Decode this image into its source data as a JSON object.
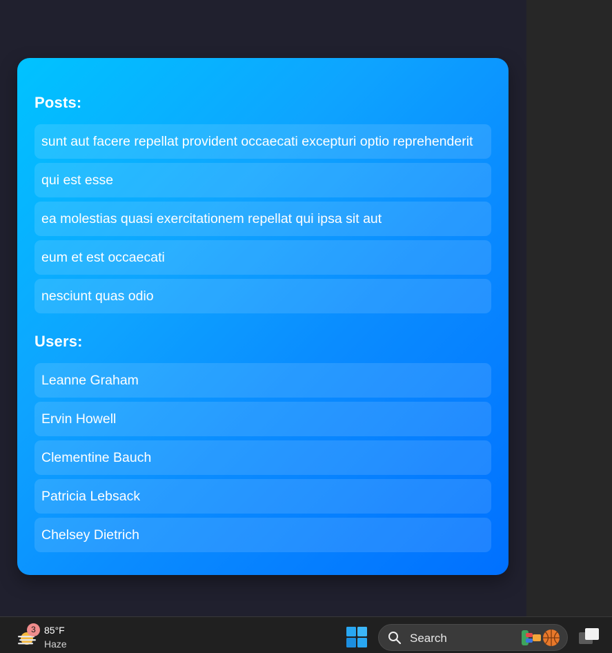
{
  "posts": {
    "title": "Posts:",
    "items": [
      "sunt aut facere repellat provident occaecati excepturi optio reprehenderit",
      "qui est esse",
      "ea molestias quasi exercitationem repellat qui ipsa sit aut",
      "eum et est occaecati",
      "nesciunt quas odio"
    ]
  },
  "users": {
    "title": "Users:",
    "items": [
      "Leanne Graham",
      "Ervin Howell",
      "Clementine Bauch",
      "Patricia Lebsack",
      "Chelsey Dietrich"
    ]
  },
  "taskbar": {
    "weather": {
      "badge": "3",
      "temperature": "85°F",
      "condition": "Haze",
      "icon": "haze-sun-icon"
    },
    "start_icon": "windows-start-icon",
    "search": {
      "label": "Search",
      "icon": "search-icon",
      "highlight_icon": "search-highlight-icon"
    },
    "taskview_icon": "task-view-icon"
  },
  "colors": {
    "card_gradient_start": "#00c3ff",
    "card_gradient_end": "#0070ff",
    "background": "#20202e",
    "taskbar": "#202020"
  }
}
